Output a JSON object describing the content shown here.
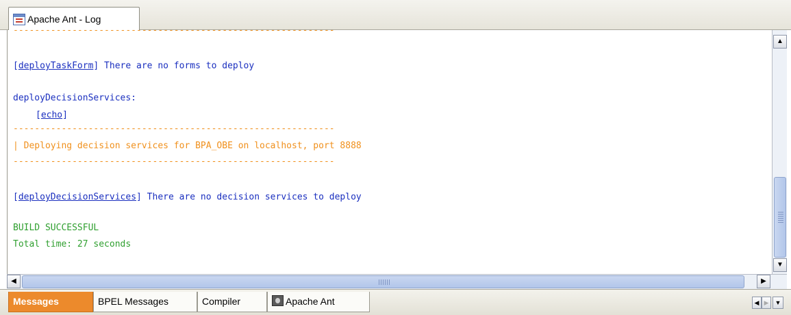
{
  "window": {
    "tab_title": "Apache Ant - Log"
  },
  "log": {
    "dash_line": "------------------------------------------------------------",
    "line1": {
      "bracket_open": "[",
      "target": "deployTaskForm",
      "bracket_close": "]",
      "message": " There are no forms to deploy"
    },
    "line2": "deployDecisionServices:",
    "line3": {
      "bracket_open": "[",
      "target": "echo",
      "bracket_close": "]"
    },
    "banner": "| Deploying decision services for BPA_OBE on localhost, port 8888",
    "line4": {
      "bracket_open": "[",
      "target": "deployDecisionServices",
      "bracket_close": "]",
      "message": " There are no decision services to deploy"
    },
    "build_status": "BUILD SUCCESSFUL",
    "total_time": "Total time: 27 seconds"
  },
  "scrollbar": {
    "up_arrow": "▲",
    "down_arrow": "▼",
    "left_arrow": "◀",
    "right_arrow": "▶"
  },
  "bottom_tabs": [
    {
      "label": "Messages",
      "active": true
    },
    {
      "label": "BPEL Messages",
      "active": false
    },
    {
      "label": "Compiler",
      "active": false
    },
    {
      "label": "Apache Ant",
      "active": false,
      "icon": "ant-icon"
    }
  ],
  "tab_nav": {
    "left": "◀",
    "right": "▶",
    "menu": "▼"
  },
  "colors": {
    "link_blue": "#1a2fbf",
    "echo_orange": "#f0901c",
    "success_green": "#2f9f2f",
    "active_tab": "#ec8a2c"
  }
}
